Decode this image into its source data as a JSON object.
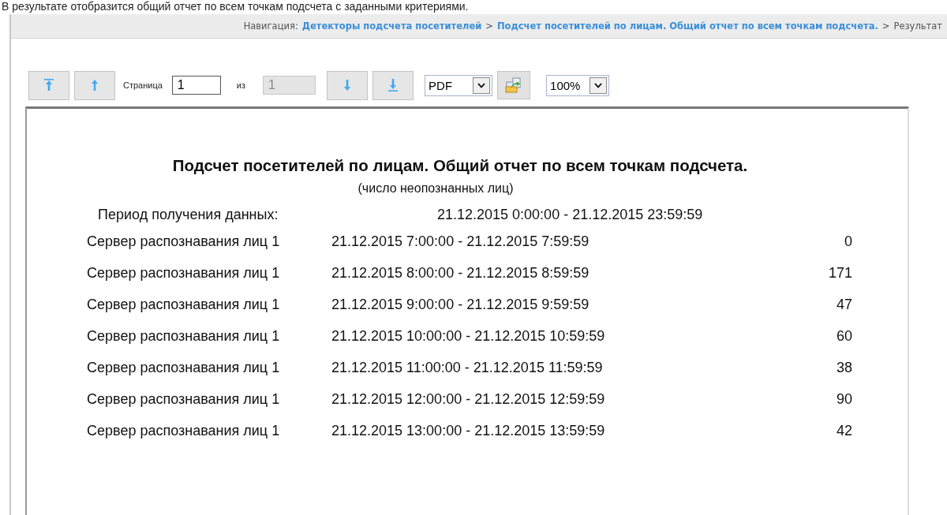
{
  "intro_text": "В результате отобразится общий отчет по всем точкам подсчета с заданными критериями.",
  "breadcrumb": {
    "label": "Навигация:",
    "items": [
      {
        "text": "Детекторы подсчета посетителей",
        "kind": "link"
      },
      {
        "text": "Подсчет посетителей по лицам. Общий отчет по всем точкам подсчета.",
        "kind": "link"
      },
      {
        "text": "Результат",
        "kind": "current"
      }
    ],
    "separator": ">"
  },
  "toolbar": {
    "page_label": "Страница",
    "page_value": "1",
    "of_label": "из",
    "total_pages": "1",
    "format": "PDF",
    "zoom": "100%"
  },
  "report": {
    "title": "Подсчет посетителей по лицам. Общий отчет по всем точкам подсчета.",
    "subtitle": "(число неопознанных лиц)",
    "period_label": "Период получения данных:",
    "period_value": "21.12.2015 0:00:00 - 21.12.2015 23:59:59",
    "rows": [
      {
        "server": "Сервер распознавания лиц 1",
        "interval": "21.12.2015 7:00:00 - 21.12.2015 7:59:59",
        "count": "0"
      },
      {
        "server": "Сервер распознавания лиц 1",
        "interval": "21.12.2015 8:00:00 - 21.12.2015 8:59:59",
        "count": "171"
      },
      {
        "server": "Сервер распознавания лиц 1",
        "interval": "21.12.2015 9:00:00 - 21.12.2015 9:59:59",
        "count": "47"
      },
      {
        "server": "Сервер распознавания лиц 1",
        "interval": "21.12.2015 10:00:00 - 21.12.2015 10:59:59",
        "count": "60"
      },
      {
        "server": "Сервер распознавания лиц 1",
        "interval": "21.12.2015 11:00:00 - 21.12.2015 11:59:59",
        "count": "38"
      },
      {
        "server": "Сервер распознавания лиц 1",
        "interval": "21.12.2015 12:00:00 - 21.12.2015 12:59:59",
        "count": "90"
      },
      {
        "server": "Сервер распознавания лиц 1",
        "interval": "21.12.2015 13:00:00 - 21.12.2015 13:59:59",
        "count": "42"
      }
    ]
  }
}
